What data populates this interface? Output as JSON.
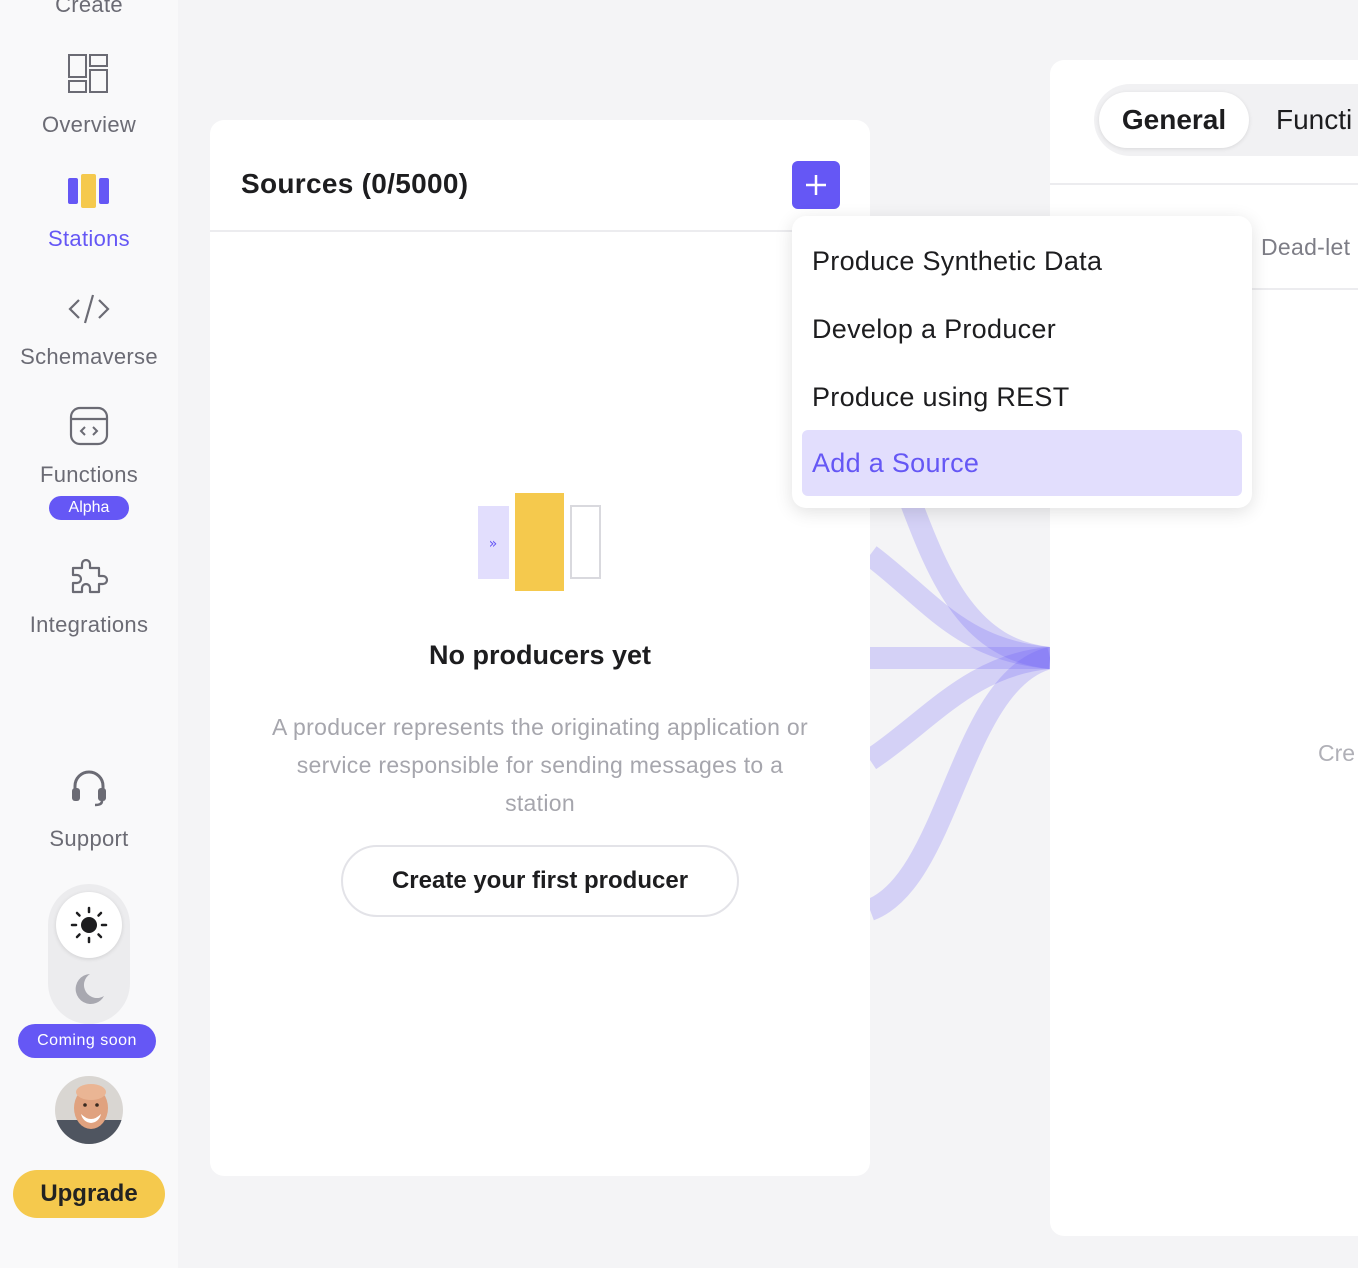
{
  "sidebar": {
    "items": [
      {
        "label": "Create",
        "icon": "create-icon"
      },
      {
        "label": "Overview",
        "icon": "dashboard-icon"
      },
      {
        "label": "Stations",
        "icon": "stations-icon",
        "active": true
      },
      {
        "label": "Schemaverse",
        "icon": "code-icon"
      },
      {
        "label": "Functions",
        "icon": "functions-icon",
        "badge": "Alpha"
      },
      {
        "label": "Integrations",
        "icon": "puzzle-icon"
      },
      {
        "label": "Support",
        "icon": "headset-icon"
      }
    ],
    "theme_toggle": {
      "selected": "light",
      "badge": "Coming soon"
    },
    "upgrade_label": "Upgrade"
  },
  "sources": {
    "title": "Sources (0/5000)",
    "empty_title": "No producers yet",
    "empty_description": "A producer represents the originating application or service responsible for sending messages to a station",
    "create_button": "Create your first producer"
  },
  "dropdown": {
    "items": [
      {
        "label": "Produce Synthetic Data"
      },
      {
        "label": "Develop a Producer"
      },
      {
        "label": "Produce using REST"
      },
      {
        "label": "Add a Source",
        "highlighted": true
      }
    ]
  },
  "station": {
    "tabs": [
      {
        "label": "General",
        "active": true
      },
      {
        "label": "Functi"
      }
    ],
    "subtab": "Dead-let",
    "create_stub": "Cre"
  },
  "colors": {
    "accent": "#6557f5",
    "upgrade": "#f5c94d",
    "highlight": "#e2defd",
    "background": "#f4f4f6"
  }
}
